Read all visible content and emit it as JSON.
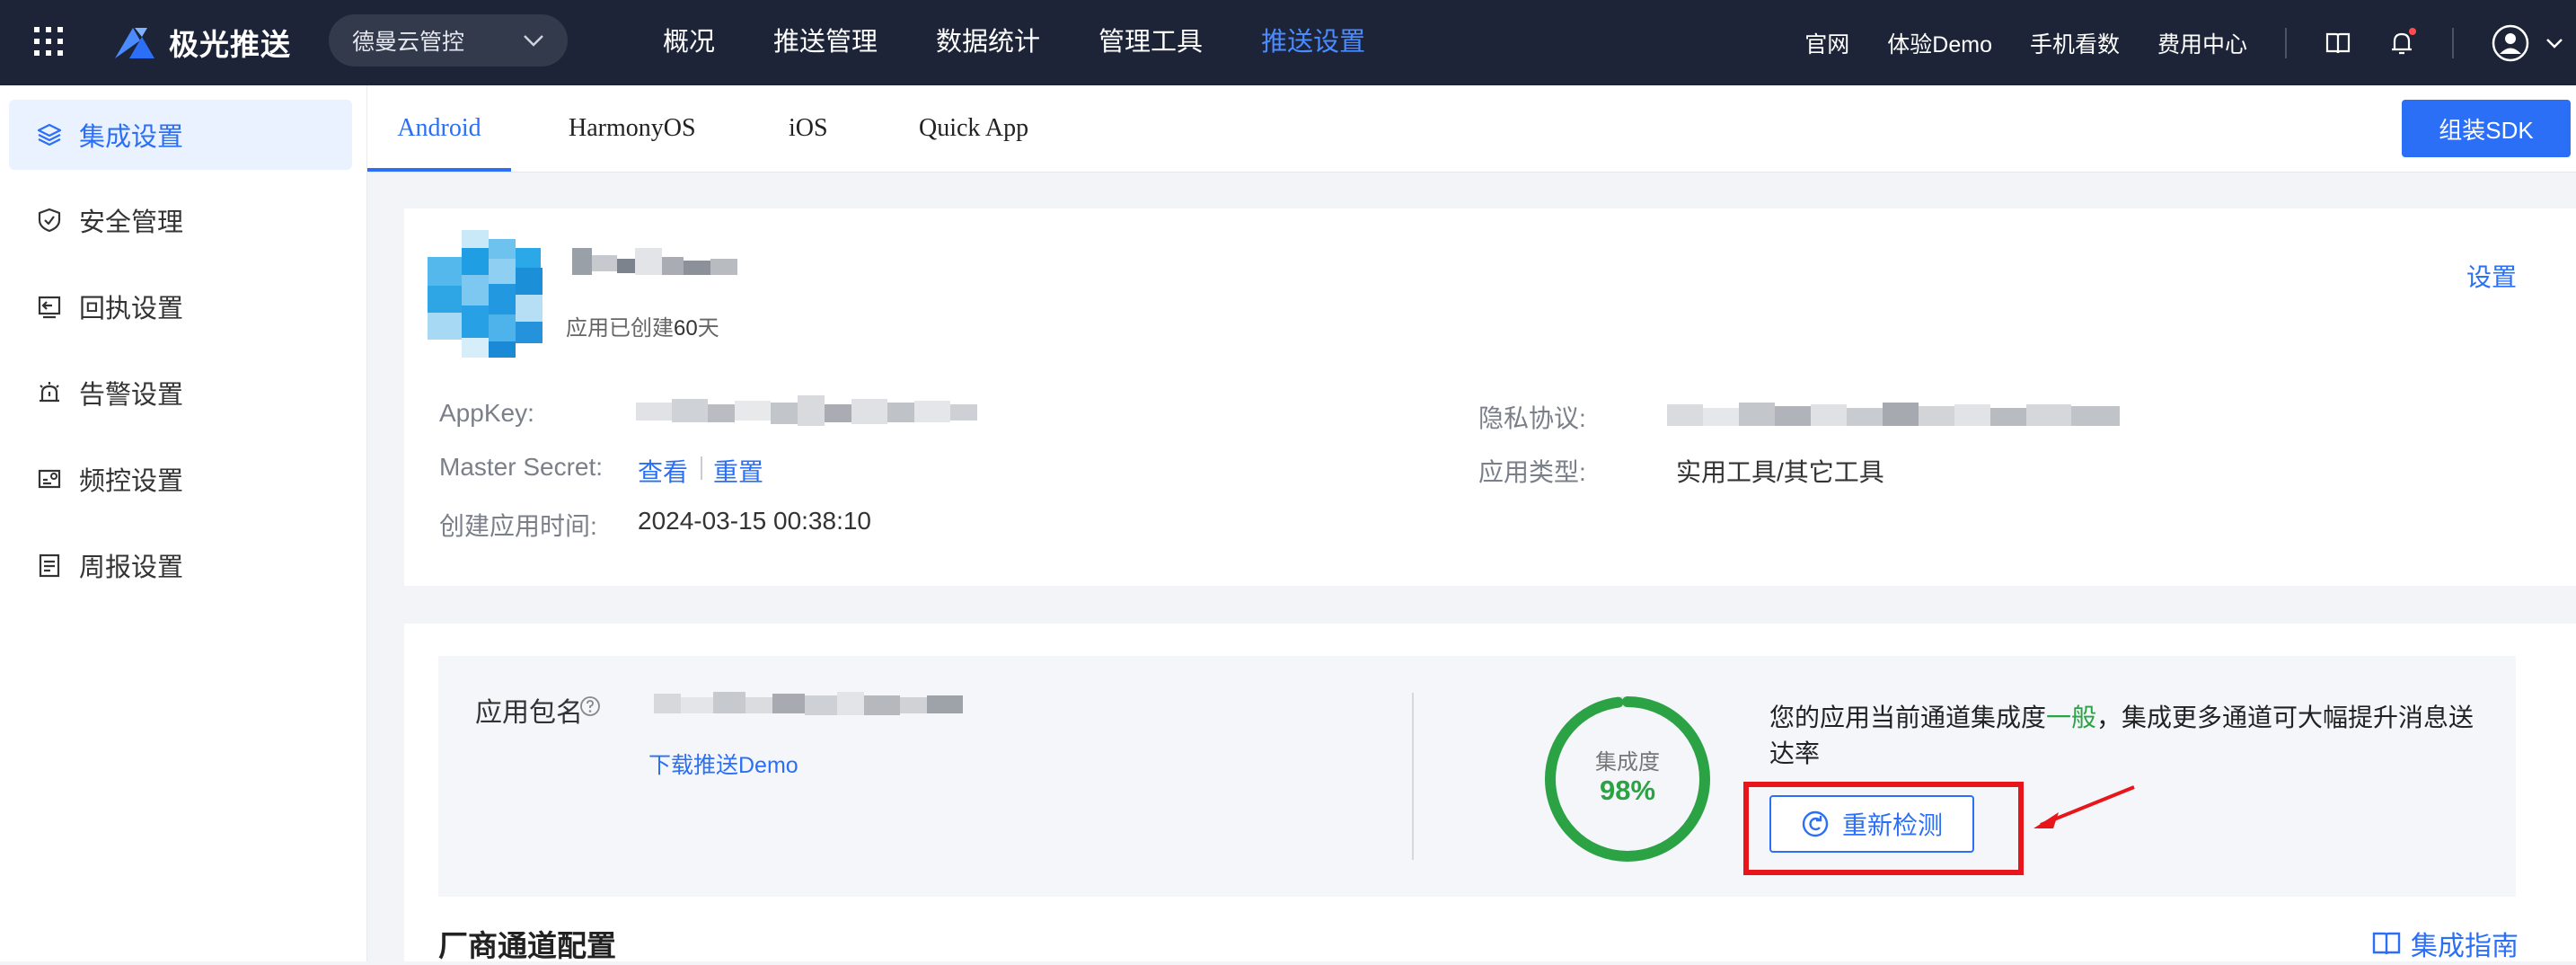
{
  "topbar": {
    "brand": "极光推送",
    "app_select": "德曼云管控",
    "nav": [
      "概况",
      "推送管理",
      "数据统计",
      "管理工具",
      "推送设置"
    ],
    "links": [
      "官网",
      "体验Demo",
      "手机看数",
      "费用中心"
    ],
    "colors": {
      "bar": "#1d2437",
      "active": "#4a8cff"
    }
  },
  "sidebar": {
    "items": [
      {
        "label": "集成设置",
        "icon": "layers-icon"
      },
      {
        "label": "安全管理",
        "icon": "shield-icon"
      },
      {
        "label": "回执设置",
        "icon": "receipt-icon"
      },
      {
        "label": "告警设置",
        "icon": "alarm-icon"
      },
      {
        "label": "频控设置",
        "icon": "frequency-icon"
      },
      {
        "label": "周报设置",
        "icon": "report-icon"
      }
    ]
  },
  "platform_tabs": [
    "Android",
    "HarmonyOS",
    "iOS",
    "Quick App"
  ],
  "sdk_button": "组装SDK",
  "app_info": {
    "created_days_prefix": "应用已创建",
    "created_days": "60",
    "created_days_suffix": "天",
    "settings": "设置",
    "appkey_label": "AppKey:",
    "master_secret_label": "Master Secret:",
    "view": "查看",
    "reset": "重置",
    "create_time_label": "创建应用时间:",
    "create_time": "2024-03-15 00:38:10",
    "privacy_label": "隐私协议:",
    "app_type_label": "应用类型:",
    "app_type": "实用工具/其它工具"
  },
  "channel": {
    "package_label": "应用包名",
    "download_demo": "下载推送Demo",
    "ring_label": "集成度",
    "ring_value": "98%",
    "ring_fraction": 0.98,
    "hint_prefix": "您的应用当前通道集成度",
    "hint_level": "一般",
    "hint_suffix": "，集成更多通道可大幅提升消息送达率",
    "recheck": "重新检测",
    "section_title": "厂商通道配置",
    "guide": "集成指南"
  }
}
